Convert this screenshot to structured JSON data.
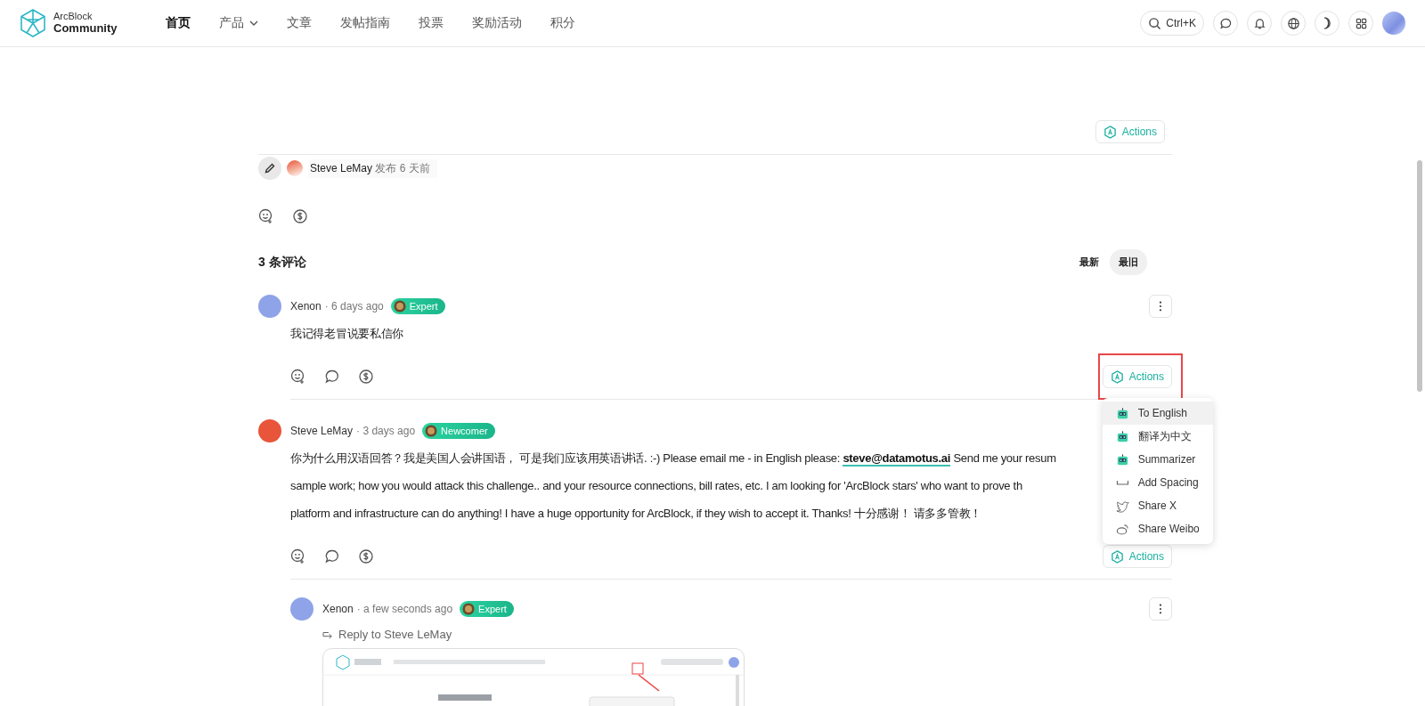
{
  "header": {
    "logo": {
      "line1": "ArcBlock",
      "line2": "Community"
    },
    "nav": [
      {
        "label": "首页",
        "selected": true,
        "dropdown": false
      },
      {
        "label": "产品",
        "selected": false,
        "dropdown": true
      },
      {
        "label": "文章",
        "selected": false,
        "dropdown": false
      },
      {
        "label": "发帖指南",
        "selected": false,
        "dropdown": false
      },
      {
        "label": "投票",
        "selected": false,
        "dropdown": false
      },
      {
        "label": "奖励活动",
        "selected": false,
        "dropdown": false
      },
      {
        "label": "积分",
        "selected": false,
        "dropdown": false
      }
    ],
    "search": {
      "shortcut": "Ctrl+K"
    }
  },
  "post": {
    "actions_label": "Actions",
    "author": "Steve LeMay",
    "published": "发布 6 天前"
  },
  "comments_header": {
    "title": "3 条评论",
    "sort": [
      {
        "label": "最新",
        "selected": false
      },
      {
        "label": "最旧",
        "selected": true
      }
    ]
  },
  "comments": [
    {
      "author": "Xenon",
      "color": "#8fa3e8",
      "time": "· 6 days ago",
      "badge": "Expert",
      "more_button": true,
      "text_lines": [
        {
          "before": "我记得老冒说要私信你"
        }
      ],
      "actions_label": "Actions",
      "actions_annotated": true
    },
    {
      "author": "Steve LeMay",
      "color": "#e8553a",
      "time": "· 3 days ago",
      "badge": "Newcomer",
      "text_lines": [
        {
          "before": "你为什么用汉语回答？我是美国人会讲国语， 可是我们应该用英语讲话. :-)  Please email me - in English please: ",
          "link": "steve@datamotus.ai",
          "after": "  Send me your resum"
        },
        {
          "before": "sample work; how you would attack this challenge.. and your resource connections, bill rates, etc.  I am looking for 'ArcBlock stars' who want to prove th"
        },
        {
          "before": "platform and infrastructure can do anything!  I have a huge opportunity for ArcBlock, if they wish to accept it.  Thanks!  十分感谢！  请多多管教！"
        }
      ],
      "actions_label": "Actions",
      "actions_annotated": false,
      "replies": [
        {
          "author": "Xenon",
          "color": "#8fa3e8",
          "time": "· a few seconds ago",
          "badge": "Expert",
          "more_button": true,
          "reply_to": "Reply to Steve LeMay"
        }
      ]
    }
  ],
  "actions_menu": [
    {
      "label": "To English",
      "kind": "ai",
      "selected": true
    },
    {
      "label": "翻译为中文",
      "kind": "ai",
      "selected": false
    },
    {
      "label": "Summarizer",
      "kind": "ai",
      "selected": false
    },
    {
      "label": "Add Spacing",
      "kind": "spacing",
      "selected": false
    },
    {
      "label": "Share X",
      "kind": "share-x",
      "selected": false
    },
    {
      "label": "Share Weibo",
      "kind": "share-weibo",
      "selected": false
    }
  ]
}
